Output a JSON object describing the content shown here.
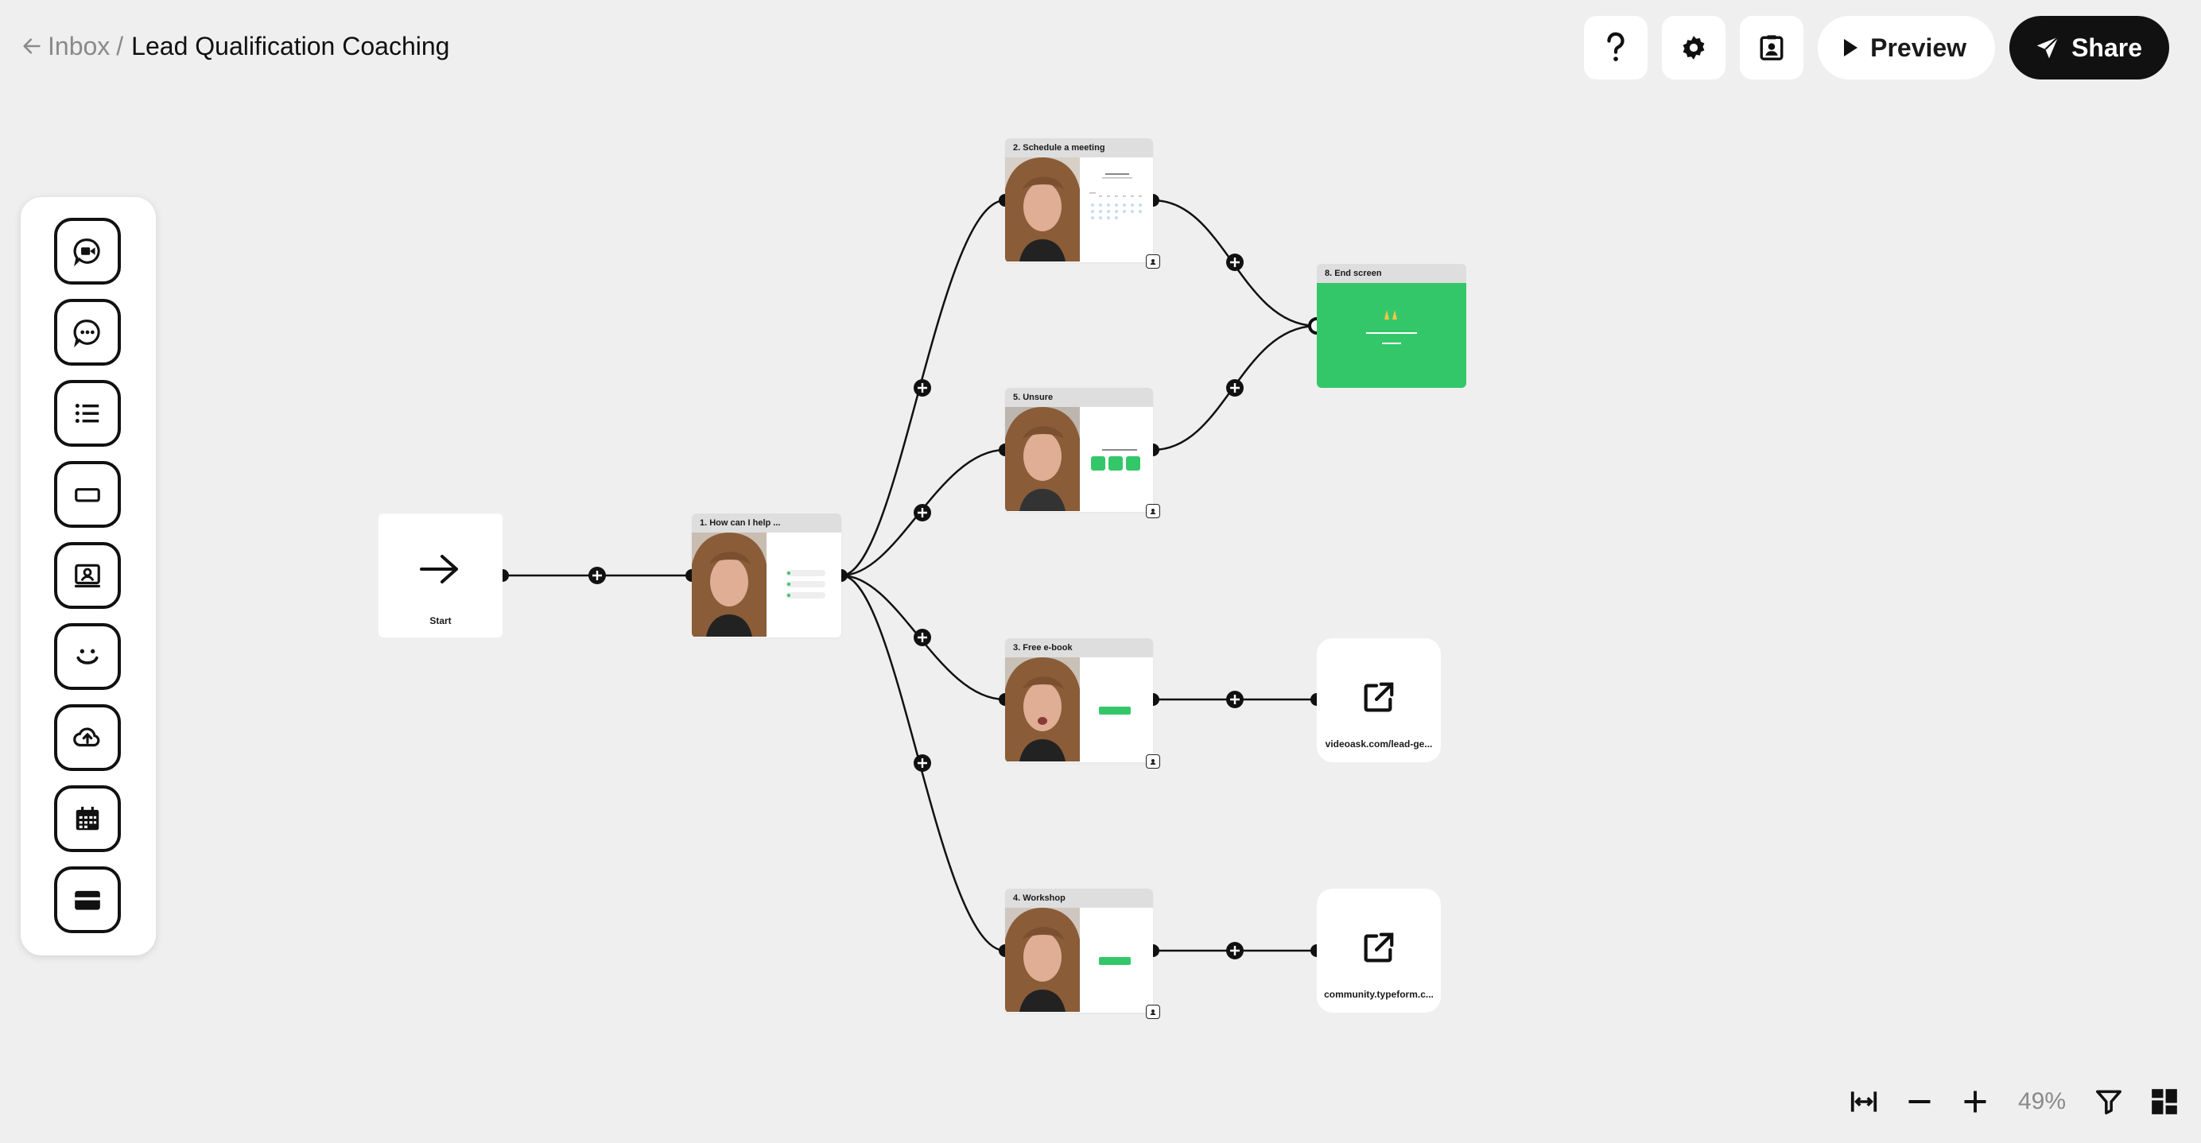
{
  "header": {
    "back_label": "Inbox",
    "separator": "/",
    "title": "Lead Qualification Coaching",
    "preview_label": "Preview",
    "share_label": "Share",
    "icons": [
      "help-icon",
      "settings-icon",
      "contact-card-icon"
    ]
  },
  "toolbox": {
    "tools": [
      "video-question-icon",
      "chat-question-icon",
      "multiple-choice-icon",
      "button-icon",
      "contact-form-icon",
      "nps-icon",
      "file-upload-icon",
      "calendar-icon",
      "payment-icon"
    ]
  },
  "nodes": {
    "start": "Start",
    "n1": "1. How can I help ...",
    "n2": "2. Schedule a meeting",
    "n3": "3. Free e-book",
    "n4": "4. Workshop",
    "n5": "5. Unsure",
    "n8": "8. End screen",
    "link1": "videoask.com/lead-ge...",
    "link2": "community.typeform.c..."
  },
  "zoom": {
    "level": "49%"
  },
  "colors": {
    "accent_green": "#34c76a",
    "dark": "#111111",
    "background": "#efefef"
  }
}
